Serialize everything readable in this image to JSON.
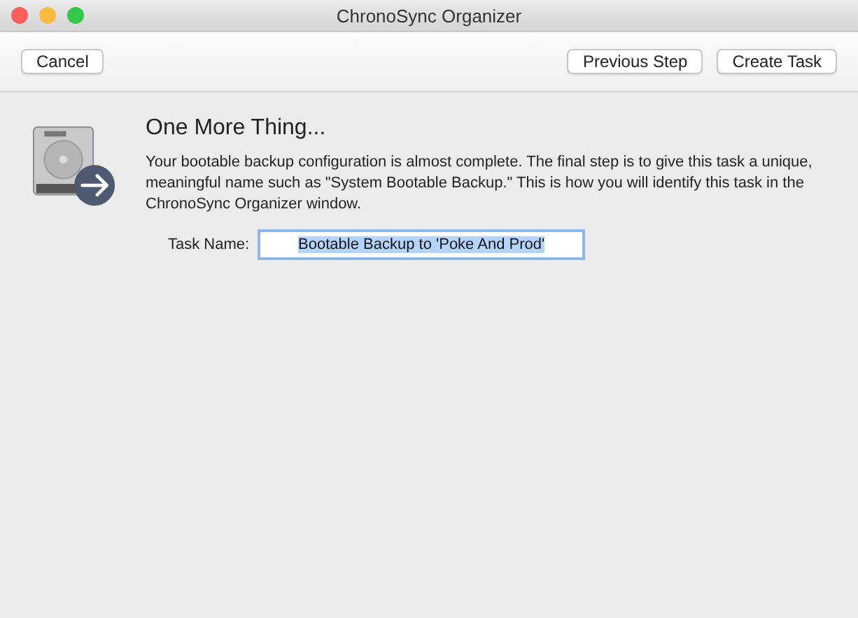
{
  "window": {
    "title": "ChronoSync Organizer"
  },
  "toolbar": {
    "left_buttons": [
      "Cancel"
    ],
    "right_buttons": [
      "Previous Step",
      "Create Task"
    ]
  },
  "content": {
    "heading": "One More Thing...",
    "description": "Your bootable backup configuration is almost complete. The final step is to give this task a unique, meaningful name such as \"System Bootable Backup.\" This is how you will identify this task in the ChronoSync Organizer window.",
    "field": {
      "label": "Task Name:",
      "value": "Bootable Backup to 'Poke And Prod'",
      "focused": true,
      "text_selected": true
    }
  }
}
